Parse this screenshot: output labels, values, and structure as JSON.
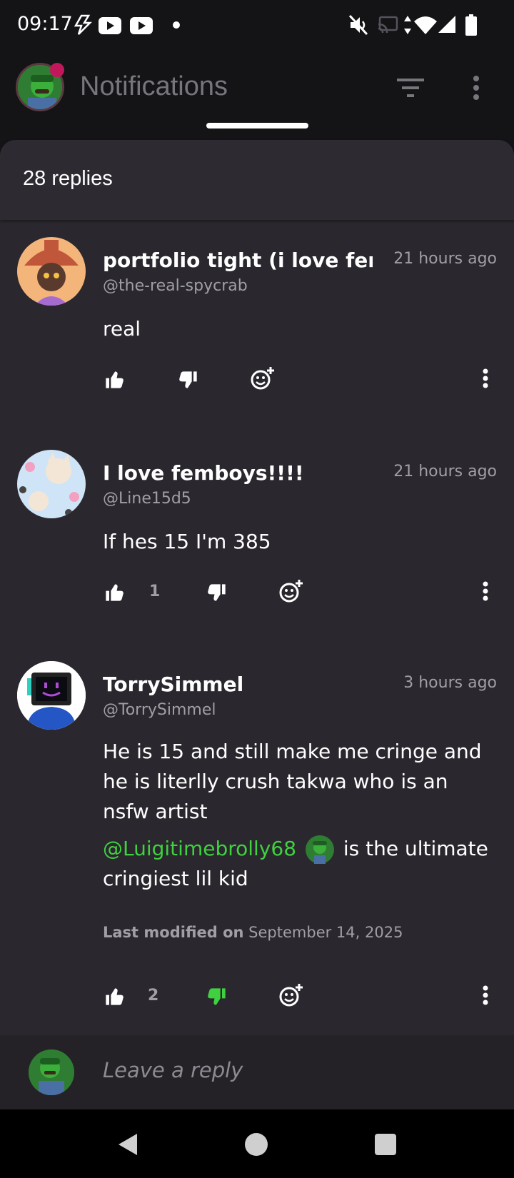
{
  "status_bar": {
    "time": "09:17"
  },
  "header": {
    "title": "Notifications"
  },
  "sheet": {
    "replies_count": "28 replies"
  },
  "comments": [
    {
      "display_name": "portfolio tight (i love femb",
      "handle": "@the-real-spycrab",
      "time": "21 hours ago",
      "body": "real",
      "likes": "",
      "disliked": false
    },
    {
      "display_name": "I love femboys!!!!",
      "handle": "@Line15d5",
      "time": "21 hours ago",
      "body": "If hes 15 I'm 385",
      "likes": "1",
      "disliked": false
    },
    {
      "display_name": "TorrySimmel",
      "handle": "@TorrySimmel",
      "time": "3 hours ago",
      "body": "He is 15 and still make me cringe and he is literlly crush takwa who is an nsfw artist",
      "mention": "@Luigitimebrolly68",
      "body2": " is the ultimate cringiest lil kid",
      "modified_label": "Last modified on",
      "modified_date": "September 14, 2025",
      "likes": "2",
      "disliked": true
    }
  ],
  "reply_bar": {
    "placeholder": "Leave a reply"
  },
  "colors": {
    "accent_green": "#3fd13f",
    "notification_dot": "#c2185b"
  }
}
